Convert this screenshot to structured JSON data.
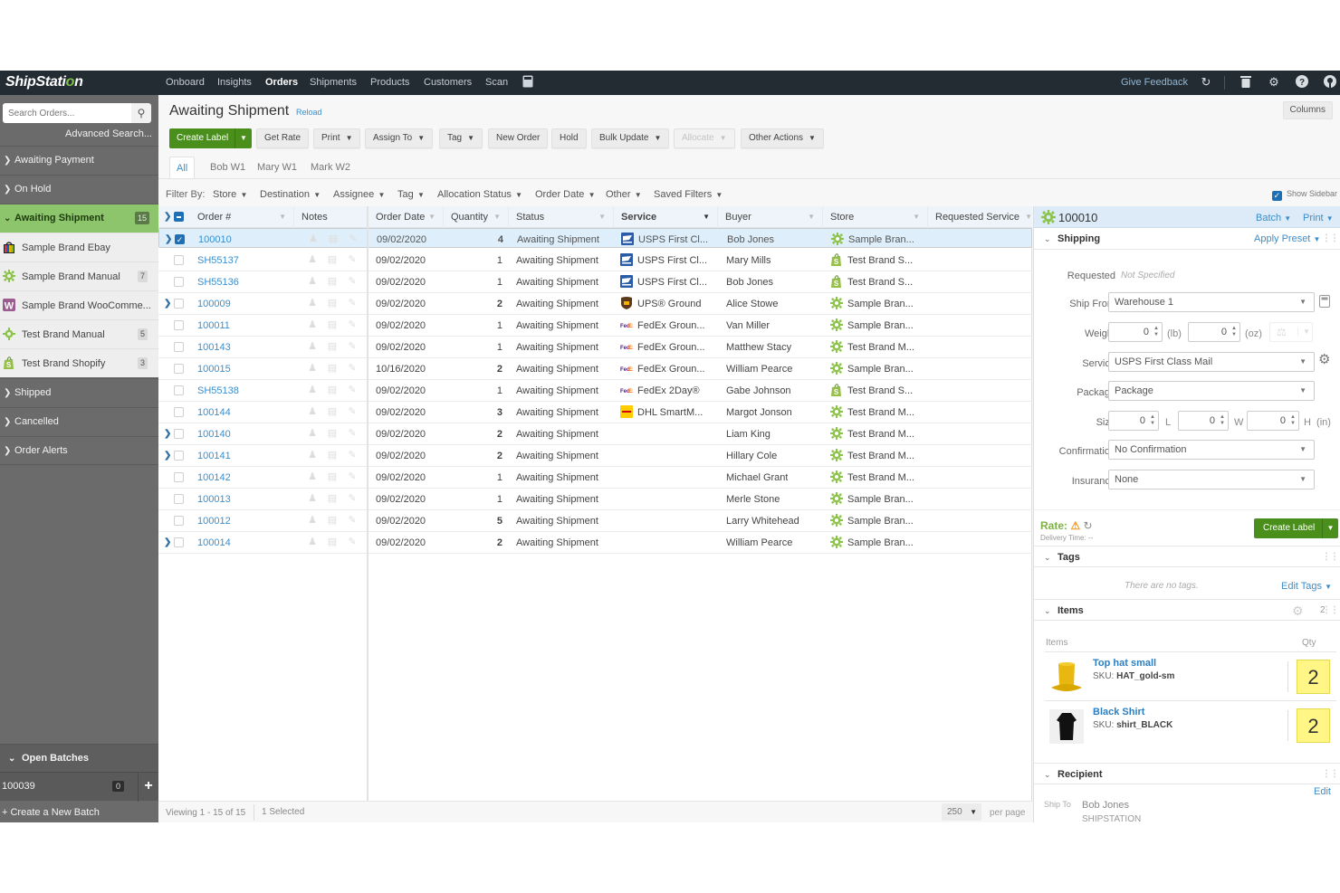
{
  "app": {
    "logo_prefix": "ShipStati",
    "logo_o": "o",
    "logo_suffix": "n"
  },
  "topnav": {
    "links": [
      {
        "label": "Onboard",
        "active": false
      },
      {
        "label": "Insights",
        "active": false
      },
      {
        "label": "Orders",
        "active": true
      },
      {
        "label": "Shipments",
        "active": false
      },
      {
        "label": "Products",
        "active": false
      },
      {
        "label": "Customers",
        "active": false
      },
      {
        "label": "Scan",
        "active": false
      }
    ],
    "calculator_icon": "calculator-icon",
    "feedback": "Give Feedback",
    "icons": [
      "refresh-icon",
      "trash-icon",
      "gear-icon",
      "help-icon",
      "account-icon"
    ]
  },
  "sidebar": {
    "search_placeholder": "Search Orders...",
    "advanced_search": "Advanced Search...",
    "statuses_top": [
      {
        "label": "Awaiting Payment"
      },
      {
        "label": "On Hold"
      }
    ],
    "active_status": {
      "label": "Awaiting Shipment",
      "count": "15"
    },
    "stores": [
      {
        "label": "Sample Brand Ebay",
        "icon": "ebay-icon",
        "count": ""
      },
      {
        "label": "Sample Brand Manual",
        "icon": "gear-store-icon",
        "count": "7"
      },
      {
        "label": "Sample Brand WooComme...",
        "icon": "woocommerce-icon",
        "count": ""
      },
      {
        "label": "Test Brand Manual",
        "icon": "gear-store-icon",
        "count": "5"
      },
      {
        "label": "Test Brand Shopify",
        "icon": "shopify-icon",
        "count": "3"
      }
    ],
    "statuses_bottom": [
      {
        "label": "Shipped"
      },
      {
        "label": "Cancelled"
      },
      {
        "label": "Order Alerts"
      }
    ],
    "open_batches": "Open Batches",
    "batch": {
      "id": "100039",
      "count": "0"
    },
    "create_batch": "+ Create a New Batch"
  },
  "main": {
    "title": "Awaiting Shipment",
    "reload": "Reload",
    "columns_btn": "Columns",
    "toolbar": {
      "create_label": "Create Label",
      "get_rate": "Get Rate",
      "print": "Print",
      "assign_to": "Assign To",
      "tag": "Tag",
      "new_order": "New Order",
      "hold": "Hold",
      "bulk_update": "Bulk Update",
      "allocate": "Allocate",
      "other_actions": "Other Actions"
    },
    "tabs": [
      "All",
      "Bob W1",
      "Mary W1",
      "Mark W2"
    ],
    "filter_by": "Filter By:",
    "filters": [
      "Store",
      "Destination",
      "Assignee",
      "Tag",
      "Allocation Status",
      "Order Date",
      "Other",
      "Saved Filters"
    ],
    "show_sidebar": "Show Sidebar"
  },
  "grid": {
    "columns": [
      "Order #",
      "Notes",
      "Order Date",
      "Quantity",
      "Status",
      "Service",
      "Buyer",
      "Store",
      "Requested Service"
    ],
    "rows": [
      {
        "order": "100010",
        "date": "09/02/2020",
        "qty": "4",
        "status": "Awaiting Shipment",
        "service": "USPS First Cl...",
        "carrier": "usps",
        "buyer": "Bob Jones",
        "store": "Sample Bran...",
        "store_type": "gear",
        "expand": true,
        "selected": true
      },
      {
        "order": "SH55137",
        "date": "09/02/2020",
        "qty": "1",
        "status": "Awaiting Shipment",
        "service": "USPS First Cl...",
        "carrier": "usps",
        "buyer": "Mary Mills",
        "store": "Test Brand S...",
        "store_type": "shopify",
        "expand": false,
        "selected": false
      },
      {
        "order": "SH55136",
        "date": "09/02/2020",
        "qty": "1",
        "status": "Awaiting Shipment",
        "service": "USPS First Cl...",
        "carrier": "usps",
        "buyer": "Bob Jones",
        "store": "Test Brand S...",
        "store_type": "shopify",
        "expand": false,
        "selected": false
      },
      {
        "order": "100009",
        "date": "09/02/2020",
        "qty": "2",
        "status": "Awaiting Shipment",
        "service": "UPS® Ground",
        "carrier": "ups",
        "buyer": "Alice Stowe",
        "store": "Sample Bran...",
        "store_type": "gear",
        "expand": true,
        "selected": false
      },
      {
        "order": "100011",
        "date": "09/02/2020",
        "qty": "1",
        "status": "Awaiting Shipment",
        "service": "FedEx Groun...",
        "carrier": "fedex",
        "buyer": "Van Miller",
        "store": "Sample Bran...",
        "store_type": "gear",
        "expand": false,
        "selected": false
      },
      {
        "order": "100143",
        "date": "09/02/2020",
        "qty": "1",
        "status": "Awaiting Shipment",
        "service": "FedEx Groun...",
        "carrier": "fedex",
        "buyer": "Matthew Stacy",
        "store": "Test Brand M...",
        "store_type": "gear",
        "expand": false,
        "selected": false
      },
      {
        "order": "100015",
        "date": "10/16/2020",
        "qty": "2",
        "status": "Awaiting Shipment",
        "service": "FedEx Groun...",
        "carrier": "fedex",
        "buyer": "William Pearce",
        "store": "Sample Bran...",
        "store_type": "gear",
        "expand": false,
        "selected": false
      },
      {
        "order": "SH55138",
        "date": "09/02/2020",
        "qty": "1",
        "status": "Awaiting Shipment",
        "service": "FedEx 2Day®",
        "carrier": "fedex",
        "buyer": "Gabe Johnson",
        "store": "Test Brand S...",
        "store_type": "shopify",
        "expand": false,
        "selected": false
      },
      {
        "order": "100144",
        "date": "09/02/2020",
        "qty": "3",
        "status": "Awaiting Shipment",
        "service": "DHL SmartM...",
        "carrier": "dhl",
        "buyer": "Margot Jonson",
        "store": "Test Brand M...",
        "store_type": "gear",
        "expand": false,
        "selected": false
      },
      {
        "order": "100140",
        "date": "09/02/2020",
        "qty": "2",
        "status": "Awaiting Shipment",
        "service": "",
        "carrier": "",
        "buyer": "Liam King",
        "store": "Test Brand M...",
        "store_type": "gear",
        "expand": true,
        "selected": false
      },
      {
        "order": "100141",
        "date": "09/02/2020",
        "qty": "2",
        "status": "Awaiting Shipment",
        "service": "",
        "carrier": "",
        "buyer": "Hillary Cole",
        "store": "Test Brand M...",
        "store_type": "gear",
        "expand": true,
        "selected": false
      },
      {
        "order": "100142",
        "date": "09/02/2020",
        "qty": "1",
        "status": "Awaiting Shipment",
        "service": "",
        "carrier": "",
        "buyer": "Michael Grant",
        "store": "Test Brand M...",
        "store_type": "gear",
        "expand": false,
        "selected": false
      },
      {
        "order": "100013",
        "date": "09/02/2020",
        "qty": "1",
        "status": "Awaiting Shipment",
        "service": "",
        "carrier": "",
        "buyer": "Merle Stone",
        "store": "Sample Bran...",
        "store_type": "gear",
        "expand": false,
        "selected": false
      },
      {
        "order": "100012",
        "date": "09/02/2020",
        "qty": "5",
        "status": "Awaiting Shipment",
        "service": "",
        "carrier": "",
        "buyer": "Larry Whitehead",
        "store": "Sample Bran...",
        "store_type": "gear",
        "expand": false,
        "selected": false
      },
      {
        "order": "100014",
        "date": "09/02/2020",
        "qty": "2",
        "status": "Awaiting Shipment",
        "service": "",
        "carrier": "",
        "buyer": "William Pearce",
        "store": "Sample Bran...",
        "store_type": "gear",
        "expand": true,
        "selected": false
      }
    ],
    "footer": {
      "viewing": "Viewing 1 - 15 of 15",
      "selected": "1 Selected",
      "per_page_value": "250",
      "per_page_label": "per page"
    }
  },
  "panel": {
    "order_number": "100010",
    "batch": "Batch",
    "print": "Print",
    "shipping": {
      "title": "Shipping",
      "apply_preset": "Apply Preset",
      "requested_label": "Requested",
      "requested_value": "Not Specified",
      "ship_from_label": "Ship From",
      "ship_from_value": "Warehouse 1",
      "weight_label": "Weight",
      "weight_lb": "0",
      "weight_oz": "0",
      "lb_unit": "(lb)",
      "oz_unit": "(oz)",
      "service_label": "Service",
      "service_value": "USPS First Class Mail",
      "package_label": "Package",
      "package_value": "Package",
      "size_label": "Size",
      "size_l": "0",
      "size_w": "0",
      "size_h": "0",
      "l_unit": "L",
      "w_unit": "W",
      "h_unit": "H  (in)",
      "confirmation_label": "Confirmation",
      "confirmation_value": "No Confirmation",
      "insurance_label": "Insurance",
      "insurance_value": "None",
      "rate_label": "Rate:",
      "delivery_time": "Delivery Time: --",
      "create_label": "Create Label"
    },
    "tags": {
      "title": "Tags",
      "empty": "There are no tags.",
      "edit": "Edit Tags"
    },
    "items": {
      "title": "Items",
      "count": "2",
      "col_items": "Items",
      "col_qty": "Qty",
      "list": [
        {
          "name": "Top hat small",
          "sku_label": "SKU:",
          "sku": "HAT_gold-sm",
          "qty": "2",
          "image": "top-hat"
        },
        {
          "name": "Black Shirt",
          "sku_label": "SKU:",
          "sku": "shirt_BLACK",
          "qty": "2",
          "image": "black-shirt"
        }
      ]
    },
    "recipient": {
      "title": "Recipient",
      "edit": "Edit",
      "ship_to": "Ship To",
      "name": "Bob Jones",
      "company": "SHIPSTATION"
    }
  },
  "colors": {
    "brand_green": "#4a8f1c",
    "active_green": "#8cc56b",
    "link_blue": "#3b8ecb",
    "nav_dark": "#232b33",
    "qty_yellow": "#fff685"
  }
}
